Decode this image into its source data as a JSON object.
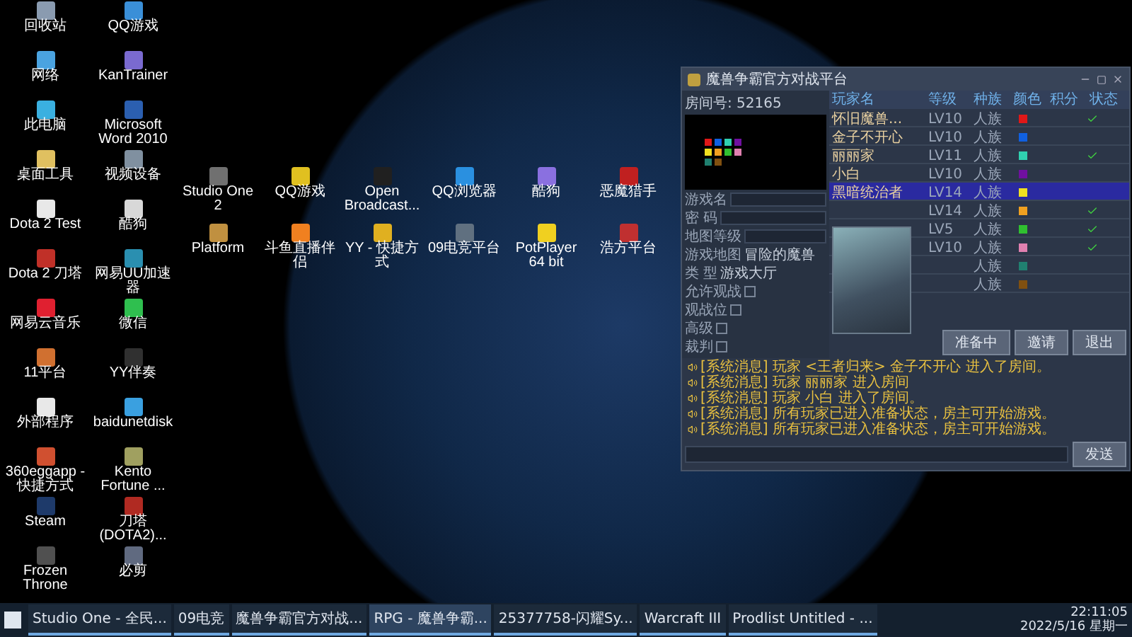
{
  "desktop_icons": [
    {
      "label": "回收站",
      "color": "#8a9bb0"
    },
    {
      "label": "QQ游戏",
      "color": "#3a8fd8"
    },
    {
      "label": "网络",
      "color": "#4aa3e0"
    },
    {
      "label": "KanTrainer",
      "color": "#7a6ad0"
    },
    {
      "label": "此电脑",
      "color": "#3ab0e0"
    },
    {
      "label": "Microsoft Word 2010",
      "color": "#2b5fb0"
    },
    {
      "label": "桌面工具",
      "color": "#e0c060"
    },
    {
      "label": "视频设备",
      "color": "#8090a0"
    },
    {
      "label": "Dota 2 Test",
      "color": "#e8e8e8"
    },
    {
      "label": "酷狗",
      "color": "#d8d8d8"
    },
    {
      "label": "Dota 2 刀塔",
      "color": "#c03028"
    },
    {
      "label": "网易UU加速器",
      "color": "#2a8fb0"
    },
    {
      "label": "网易云音乐",
      "color": "#e02030"
    },
    {
      "label": "微信",
      "color": "#2fbf4f"
    },
    {
      "label": "11平台",
      "color": "#d07030"
    },
    {
      "label": "YY伴奏",
      "color": "#303030"
    },
    {
      "label": "外部程序",
      "color": "#e8e8e8"
    },
    {
      "label": "baidunetdisk",
      "color": "#3aa0e0"
    },
    {
      "label": "360eggapp - 快捷方式",
      "color": "#d05030"
    },
    {
      "label": "Kento Fortune ...",
      "color": "#a0a060"
    },
    {
      "label": "Steam",
      "color": "#1e3a6a"
    },
    {
      "label": "刀塔 (DOTA2)...",
      "color": "#b02a22"
    },
    {
      "label": "Frozen Throne",
      "color": "#505050"
    },
    {
      "label": "必剪",
      "color": "#606a80"
    }
  ],
  "shortcut_icons": [
    {
      "label": "Studio One 2",
      "color": "#707070"
    },
    {
      "label": "QQ游戏",
      "color": "#e0c020"
    },
    {
      "label": "Open Broadcast...",
      "color": "#202020"
    },
    {
      "label": "QQ浏览器",
      "color": "#2a90e0"
    },
    {
      "label": "酷狗",
      "color": "#8a70e0"
    },
    {
      "label": "恶魔猎手",
      "color": "#c02020"
    },
    {
      "label": "Platform",
      "color": "#c09040"
    },
    {
      "label": "斗鱼直播伴侣",
      "color": "#f08020"
    },
    {
      "label": "YY - 快捷方式",
      "color": "#e0b020"
    },
    {
      "label": "09电竞平台",
      "color": "#607080"
    },
    {
      "label": "PotPlayer 64 bit",
      "color": "#f0d020"
    },
    {
      "label": "浩方平台",
      "color": "#c03030"
    }
  ],
  "window": {
    "title": "魔兽争霸官方对战平台",
    "room_label": "房间号: 52165",
    "settings": [
      {
        "label": "游戏名",
        "kind": "field"
      },
      {
        "label": "密 码",
        "kind": "field"
      },
      {
        "label": "地图等级",
        "kind": "field"
      },
      {
        "label": "游戏地图",
        "kind": "text",
        "value": "冒险的魔兽"
      },
      {
        "label": "类 型",
        "kind": "text",
        "value": "游戏大厅"
      },
      {
        "label": "允许观战",
        "kind": "check",
        "checked": false
      },
      {
        "label": "观战位",
        "kind": "check",
        "checked": false
      },
      {
        "label": "高级",
        "kind": "check",
        "checked": false
      },
      {
        "label": "裁判",
        "kind": "check",
        "checked": false
      }
    ],
    "columns": [
      "玩家名",
      "等级",
      "种族",
      "颜色",
      "积分",
      "状态"
    ],
    "players": [
      {
        "name": "怀旧魔兽...",
        "level": "LV10",
        "race": "人族",
        "color": "#e01818",
        "ready": true,
        "selected": false
      },
      {
        "name": "金子不开心",
        "level": "LV10",
        "race": "人族",
        "color": "#1060e0",
        "ready": false,
        "selected": false
      },
      {
        "name": "丽丽家",
        "level": "LV11",
        "race": "人族",
        "color": "#30d0b0",
        "ready": true,
        "selected": false
      },
      {
        "name": "小白",
        "level": "LV10",
        "race": "人族",
        "color": "#7010a0",
        "ready": false,
        "selected": false
      },
      {
        "name": "黑暗统治者",
        "level": "LV14",
        "race": "人族",
        "color": "#f0e020",
        "ready": false,
        "selected": true
      },
      {
        "level": "LV14",
        "race": "人族",
        "color": "#f0a020",
        "ready": true,
        "selected": false
      },
      {
        "level": "LV5",
        "race": "人族",
        "color": "#30c030",
        "ready": true,
        "selected": false
      },
      {
        "level": "LV10",
        "race": "人族",
        "color": "#e080b0",
        "ready": true,
        "selected": false
      },
      {
        "race": "人族",
        "color": "#208070",
        "ready": false,
        "selected": false
      },
      {
        "race": "人族",
        "color": "#805010",
        "ready": false,
        "selected": false
      }
    ],
    "buttons": [
      "准备中",
      "邀请",
      "退出"
    ],
    "messages": [
      "[系统消息] 玩家 <王者归来> 金子不开心 进入了房间。",
      "[系统消息] 玩家 丽丽家 进入房间",
      "[系统消息] 玩家 小白 进入了房间。",
      "[系统消息] 所有玩家已进入准备状态，房主可开始游戏。",
      "[系统消息] 所有玩家已进入准备状态，房主可开始游戏。"
    ],
    "send_button": "发送"
  },
  "taskbar": {
    "tasks": [
      {
        "label": "Studio One - 全民...",
        "selected": false
      },
      {
        "label": "09电竞",
        "selected": false
      },
      {
        "label": "魔兽争霸官方对战...",
        "selected": false
      },
      {
        "label": "RPG - 魔兽争霸...",
        "selected": true
      },
      {
        "label": "25377758-闪耀Sy...",
        "selected": false
      },
      {
        "label": "Warcraft III",
        "selected": false
      },
      {
        "label": "Prodlist Untitled - ...",
        "selected": false
      }
    ],
    "time": "22:11:05",
    "date": "2022/5/16 星期一"
  }
}
